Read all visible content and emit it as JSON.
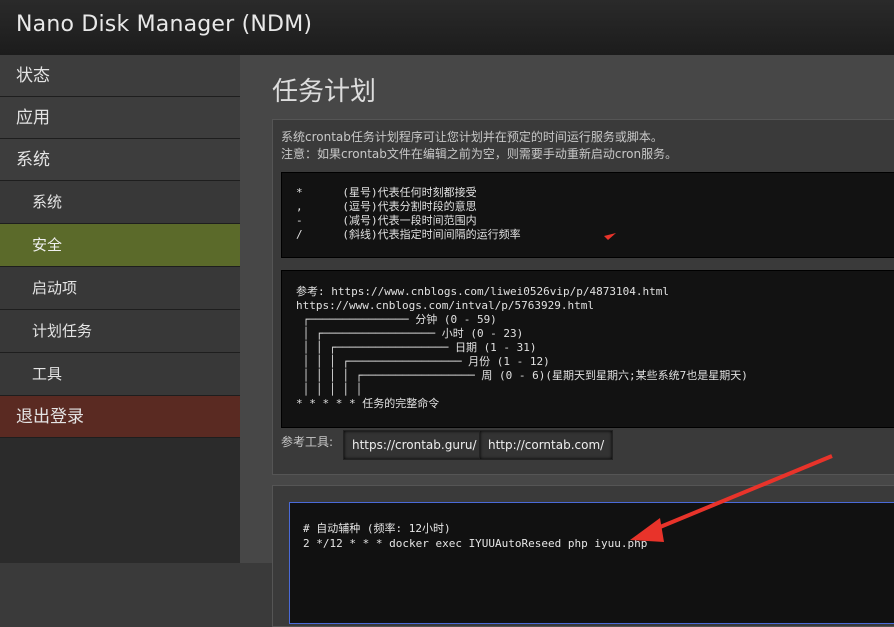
{
  "app": {
    "title": "Nano Disk Manager (NDM)"
  },
  "sidebar": {
    "items": [
      {
        "label": "状态"
      },
      {
        "label": "应用"
      },
      {
        "label": "系统"
      },
      {
        "label": "系统"
      },
      {
        "label": "安全"
      },
      {
        "label": "启动项"
      },
      {
        "label": "计划任务"
      },
      {
        "label": "工具"
      },
      {
        "label": "退出登录"
      }
    ]
  },
  "main": {
    "title": "任务计划",
    "desc_line1": "系统crontab任务计划程序可让您计划并在预定的时间运行服务或脚本。",
    "desc_line2": "注意：如果crontab文件在编辑之前为空，则需要手动重新启动cron服务。",
    "symbols": [
      "*      (星号)代表任何时刻都接受",
      ",      (逗号)代表分割时段的意思",
      "-      (减号)代表一段时间范围内",
      "/      (斜线)代表指定时间间隔的运行频率"
    ],
    "reference_lines": [
      "参考: https://www.cnblogs.com/liwei0526vip/p/4873104.html",
      "https://www.cnblogs.com/intval/p/5763929.html",
      " ┌─────────────── 分钟 (0 - 59)",
      " │ ┌───────────────── 小时 (0 - 23)",
      " │ │ ┌───────────────── 日期 (1 - 31)",
      " │ │ │ ┌───────────────── 月份 (1 - 12)",
      " │ │ │ │ ┌───────────────── 周 (0 - 6)(星期天到星期六;某些系统7也是星期天)",
      " │ │ │ │ │",
      "* * * * * 任务的完整命令"
    ],
    "tools_label": "参考工具:",
    "tool_buttons": [
      "https://crontab.guru/",
      "http://corntab.com/"
    ],
    "editor": {
      "lines": [
        "# 自动辅种 (频率: 12小时)",
        "2 */12 * * * docker exec IYUUAutoReseed php iyuu.php"
      ]
    }
  },
  "annotation": {
    "arrow_color": "#e8332a"
  }
}
